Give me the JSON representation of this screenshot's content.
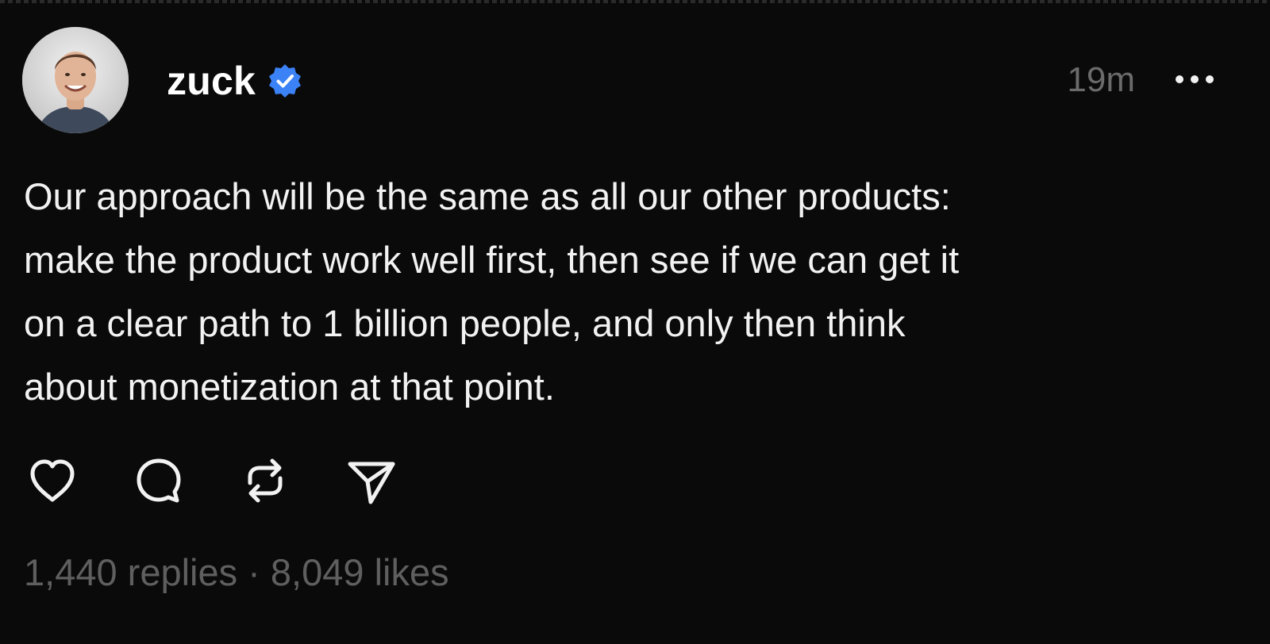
{
  "post": {
    "username": "zuck",
    "verified": true,
    "timestamp": "19m",
    "text": "Our approach will be the same as all our other products:\nmake the product work well first, then see if we can get it\non a clear path to 1 billion people, and only then think\nabout monetization at that point.",
    "stats": "1,440 replies · 8,049 likes"
  },
  "icons": {
    "avatar": "avatar",
    "verified": "verified-badge-icon",
    "more": "more-options-icon",
    "like": "heart-icon",
    "reply": "comment-icon",
    "repost": "repost-icon",
    "share": "send-icon"
  },
  "colors": {
    "background": "#0a0a0a",
    "text": "#f2f2f2",
    "muted": "#6b6b6b",
    "verified": "#3b82f6"
  }
}
